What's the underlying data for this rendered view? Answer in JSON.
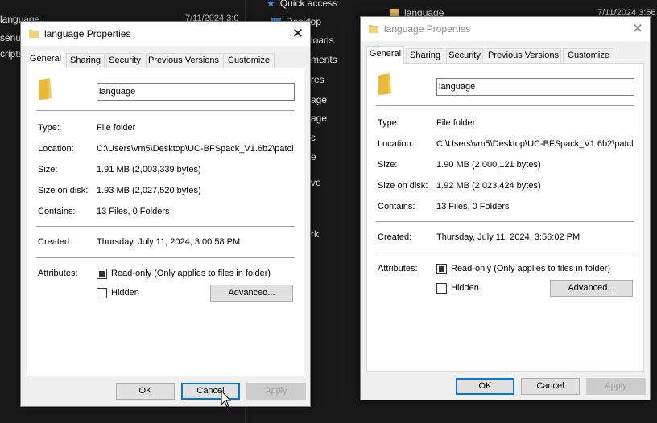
{
  "background": {
    "left_items": [
      "language",
      "senu",
      "cripts"
    ],
    "left_date": "7/11/2024 3:0",
    "nav": {
      "quick_access": "Quick access",
      "items": [
        "Desktop",
        "loads",
        "ments",
        "res",
        "age",
        "age",
        "c",
        "e",
        "ve",
        "rk"
      ]
    },
    "right_item": "language",
    "right_date": "7/11/2024 3:56"
  },
  "dialogs": [
    {
      "title": "language Properties",
      "tabs": [
        "General",
        "Sharing",
        "Security",
        "Previous Versions",
        "Customize"
      ],
      "name": "language",
      "type_label": "Type:",
      "type_value": "File folder",
      "location_label": "Location:",
      "location_value": "C:\\Users\\vm5\\Desktop\\UC-BFSpack_V1.6b2\\patcl",
      "size_label": "Size:",
      "size_value": "1.91 MB (2,003,339 bytes)",
      "size_on_disk_label": "Size on disk:",
      "size_on_disk_value": "1.93 MB (2,027,520 bytes)",
      "contains_label": "Contains:",
      "contains_value": "13 Files, 0 Folders",
      "created_label": "Created:",
      "created_value": "Thursday, July 11, 2024, 3:00:58 PM",
      "attributes_label": "Attributes:",
      "readonly_label": "Read-only (Only applies to files in folder)",
      "hidden_label": "Hidden",
      "advanced_label": "Advanced...",
      "ok_label": "OK",
      "cancel_label": "Cancel",
      "apply_label": "Apply"
    },
    {
      "title": "language Properties",
      "tabs": [
        "General",
        "Sharing",
        "Security",
        "Previous Versions",
        "Customize"
      ],
      "name": "language",
      "type_label": "Type:",
      "type_value": "File folder",
      "location_label": "Location:",
      "location_value": "C:\\Users\\vm5\\Desktop\\UC-BFSpack_V1.6b2\\patcl",
      "size_label": "Size:",
      "size_value": "1.90 MB (2,000,121 bytes)",
      "size_on_disk_label": "Size on disk:",
      "size_on_disk_value": "1.92 MB (2,023,424 bytes)",
      "contains_label": "Contains:",
      "contains_value": "13 Files, 0 Folders",
      "created_label": "Created:",
      "created_value": "Thursday, July 11, 2024, 3:56:02 PM",
      "attributes_label": "Attributes:",
      "readonly_label": "Read-only (Only applies to files in folder)",
      "hidden_label": "Hidden",
      "advanced_label": "Advanced...",
      "ok_label": "OK",
      "cancel_label": "Cancel",
      "apply_label": "Apply"
    }
  ]
}
